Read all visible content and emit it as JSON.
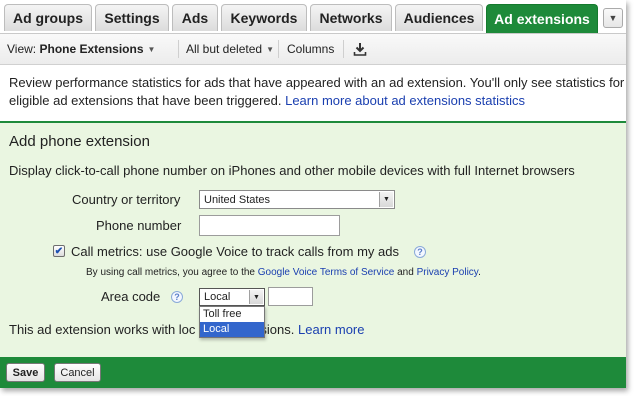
{
  "tabs": [
    {
      "label": "Ad groups",
      "active": false
    },
    {
      "label": "Settings",
      "active": false
    },
    {
      "label": "Ads",
      "active": false
    },
    {
      "label": "Keywords",
      "active": false
    },
    {
      "label": "Networks",
      "active": false
    },
    {
      "label": "Audiences",
      "active": false
    },
    {
      "label": "Ad extensions",
      "active": true
    }
  ],
  "tab_more_icon": "chevron-down-icon",
  "toolbar": {
    "view_prefix": "View: ",
    "view_value": "Phone Extensions",
    "filter_label": "All but deleted",
    "columns_label": "Columns",
    "download_icon": "download-icon"
  },
  "info": {
    "line1": "Review performance statistics for ads that have appeared with an ad extension. You'll only see statistics for",
    "line2_text": "eligible ad extensions that have been triggered. ",
    "line2_link": "Learn more about ad extensions statistics"
  },
  "form": {
    "title": "Add phone extension",
    "description": "Display click-to-call phone number on iPhones and other mobile devices with full Internet browsers",
    "country_label": "Country or territory",
    "country_value": "United States",
    "phone_label": "Phone number",
    "phone_value": "",
    "call_metrics_checked": true,
    "call_metrics_label": "Call metrics: use Google Voice to track calls from my ads",
    "terms_text": "By using call metrics, you agree to the ",
    "terms_link": "Google Voice Terms of Service",
    "terms_and": " and ",
    "privacy_link": "Privacy Policy",
    "terms_end": ".",
    "area_code_label": "Area code",
    "area_code_value": "Local",
    "area_code_options": [
      "Toll free",
      "Local"
    ],
    "area_code_selected": "Local",
    "area_code_input": "",
    "footer_text_start": "This ad extension works with loc",
    "footer_text_end": "sions. ",
    "learn_more": "Learn more"
  },
  "buttons": {
    "save": "Save",
    "cancel": "Cancel"
  },
  "colors": {
    "accent": "#1e8a3a",
    "panel_bg": "#eaf6e1",
    "link": "#1a3fb0",
    "selection": "#3366cc"
  }
}
